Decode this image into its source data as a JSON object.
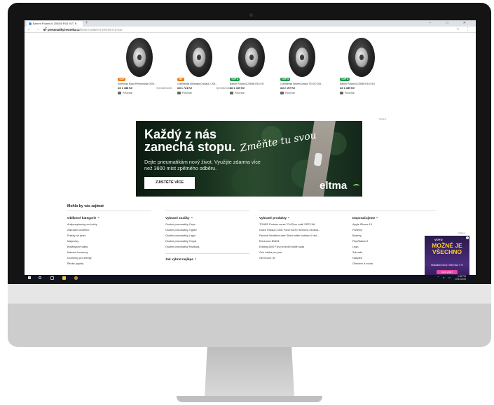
{
  "browser": {
    "tab_title": "Barum Polaris 6 205/55 R16 91T ✕",
    "new_tab": "+",
    "window_controls": "– □ ✕",
    "nav": "← → C",
    "url_host": "pneumatiky.heureka.cz",
    "url_path": "/barum-polaris-6-205-55-r16-91t/",
    "tools": "☆ ⋮"
  },
  "products": [
    {
      "badge": "TOP",
      "badge_color": "#f07b14",
      "name": "Kormoran Road Performance 205/...",
      "price": "od 1 188 Kč",
      "shop": "Specializováno",
      "compare": "Porovnat"
    },
    {
      "badge": "HIT",
      "badge_color": "#f07b14",
      "name": "Continental AllSeasonContact 2 205...",
      "price": "od 1 721 Kč",
      "shop": "Specializováno",
      "compare": "Porovnat"
    },
    {
      "badge": "TOP 2",
      "badge_color": "#1f9c4a",
      "name": "Barum Polaris 6 205/55 R16 91T",
      "price": "od 1 169 Kč",
      "shop": "",
      "compare": "Porovnat"
    },
    {
      "badge": "TOP 3",
      "badge_color": "#1f9c4a",
      "name": "Continental WinterContact TS 870 205...",
      "price": "od 2 197 Kč",
      "shop": "",
      "compare": "Porovnat"
    },
    {
      "badge": "TOP 4",
      "badge_color": "#1f9c4a",
      "name": "Barum Polaris 6 205/55 R16 91H",
      "price": "od 1 339 Kč",
      "shop": "",
      "compare": "Porovnat"
    }
  ],
  "ad": {
    "label": "Reklama",
    "headline": "Každý z nás zanechá stopu.",
    "script": "Změňte tu svou",
    "body": "Dejte pneumatikám nový život. Využijte zdarma více než 3800 míst zpětného odběru.",
    "cta": "ZJISTĚTE VÍCE",
    "logo": "eltma"
  },
  "suggestions": {
    "title": "Mohlo by vás zajímat",
    "columns": [
      {
        "title": "Oblíbené kategorie",
        "items": [
          "Antiperspiranty pro kočky",
          "Zahradní osvětlení",
          "Prášky na praní",
          "Majonézy",
          "Bowlingové tašky",
          "Masové konzervy",
          "Doménky pro křečky",
          "Řecké jogurty"
        ]
      },
      {
        "title": "Vybrané značky",
        "items": [
          "Osobní pneumatiky Onyx",
          "Osobní pneumatiky Tigitire",
          "Osobní pneumatiky Lappi",
          "Osobní pneumatiky Troyal",
          "Osobní pneumatiky Radburg"
        ],
        "sub_title": "Jak vybrat nejlépe"
      },
      {
        "title": "Vybrané produkty",
        "items": [
          "TONER Podnos nerez 27x22cm oválí SPECIAL",
          "Dutch Passion CBG Force AUTO semena neoboa...",
          "Paloma Sensitive care Shea butter balsam 4 vrst...",
          "Electrolux EMM1",
          "Edding 4400 Fixy na textil hodilé sada",
          "Orio miska pro psa",
          "GEOColor 30"
        ]
      },
      {
        "title": "Doporučujeme",
        "items": [
          "Apple iPhone 15",
          "Parfémy",
          "Bazény",
          "PlayStation 5",
          "Lego",
          "Zahrada",
          "Nábytek",
          "Oblečení a móda"
        ]
      }
    ]
  },
  "side_ad": {
    "label": "Reklama",
    "brand": "VOYO",
    "headline": "MOŽNÉ JE VŠECHNO",
    "sub": "PREMIÉROVÉ DÍLY DŘÍV NEŽ V TV",
    "cta": "CHCI VIDĚT"
  },
  "taskbar": {
    "time": "1:05 PM",
    "date": "10/11/2024",
    "tray": "⌃ ◂ ▭"
  },
  "colors": {
    "accent_orange": "#f07b14",
    "accent_green": "#1f9c4a",
    "ad_green": "#7ed957"
  }
}
